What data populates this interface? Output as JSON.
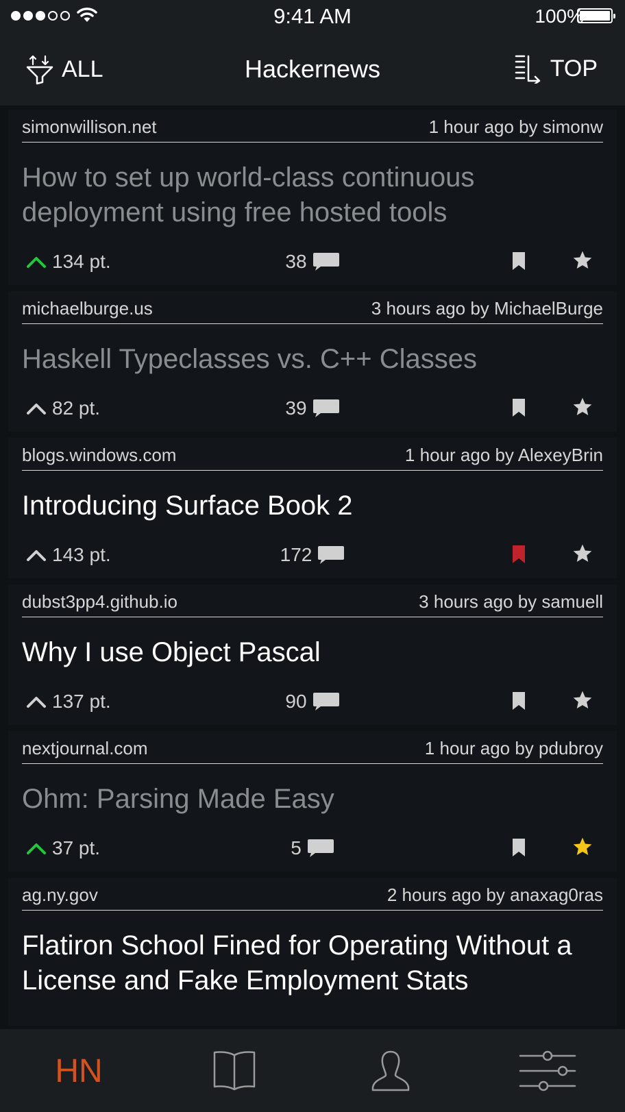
{
  "status": {
    "time": "9:41 AM",
    "battery": "100%"
  },
  "nav": {
    "filter_label": "ALL",
    "title": "Hackernews",
    "sort_label": "TOP"
  },
  "stories": [
    {
      "domain": "simonwillison.net",
      "byline": "1 hour ago by simonw",
      "title": "How to set up world-class continuous deployment using free hosted tools",
      "read": true,
      "points": "134 pt.",
      "upvoted": true,
      "comments": "38",
      "bookmarked": false,
      "starred": false
    },
    {
      "domain": "michaelburge.us",
      "byline": "3 hours ago by MichaelBurge",
      "title": "Haskell Typeclasses vs. C++ Classes",
      "read": true,
      "points": "82 pt.",
      "upvoted": false,
      "comments": "39",
      "bookmarked": false,
      "starred": false
    },
    {
      "domain": "blogs.windows.com",
      "byline": "1 hour ago by AlexeyBrin",
      "title": "Introducing Surface Book 2",
      "read": false,
      "points": "143 pt.",
      "upvoted": false,
      "comments": "172",
      "bookmarked": true,
      "starred": false
    },
    {
      "domain": "dubst3pp4.github.io",
      "byline": "3 hours ago by samuell",
      "title": "Why I use Object Pascal",
      "read": false,
      "points": "137 pt.",
      "upvoted": false,
      "comments": "90",
      "bookmarked": false,
      "starred": false
    },
    {
      "domain": "nextjournal.com",
      "byline": "1 hour ago by pdubroy",
      "title": "Ohm: Parsing Made Easy",
      "read": true,
      "points": "37 pt.",
      "upvoted": true,
      "comments": "5",
      "bookmarked": false,
      "starred": true
    },
    {
      "domain": "ag.ny.gov",
      "byline": "2 hours ago by anaxag0ras",
      "title": "Flatiron School Fined for Operating Without a License and Fake Employment Stats",
      "read": false
    }
  ],
  "tabs": {
    "hn_label": "HN"
  },
  "colors": {
    "upvoted": "#22c73a",
    "neutral": "#d0d0d0",
    "bookmarked": "#c0232b",
    "starred": "#f5c518",
    "accent": "#d2531f"
  }
}
